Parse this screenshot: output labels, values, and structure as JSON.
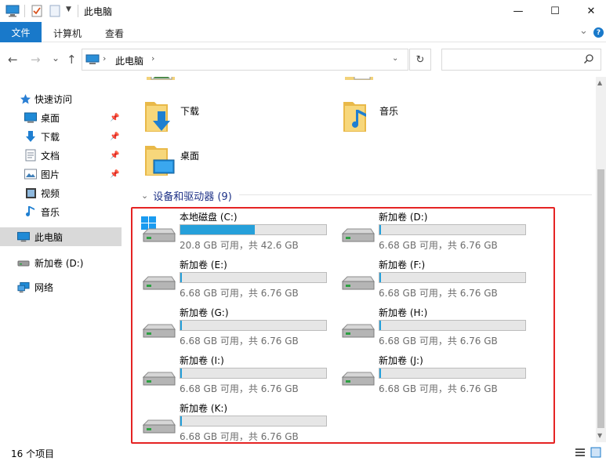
{
  "window": {
    "title": "此电脑",
    "minimize": "—",
    "maximize": "☐",
    "close": "✕"
  },
  "ribbon": {
    "tabs": [
      "文件",
      "计算机",
      "查看"
    ],
    "collapse": "⌄",
    "help": "?"
  },
  "nav": {
    "back": "←",
    "forward": "→",
    "recent": "⌄",
    "up": "↑",
    "address_root_chevron": "›",
    "address_location": "此电脑",
    "address_chevron": "›",
    "address_dropdown": "⌄",
    "refresh": "↻",
    "search_placeholder": ""
  },
  "sidebar": {
    "quick_access": "快速访问",
    "items": [
      {
        "label": "桌面",
        "icon": "desktop-icon",
        "pinned": true
      },
      {
        "label": "下载",
        "icon": "download-icon",
        "pinned": true
      },
      {
        "label": "文档",
        "icon": "document-icon",
        "pinned": true
      },
      {
        "label": "图片",
        "icon": "picture-icon",
        "pinned": true
      },
      {
        "label": "视频",
        "icon": "video-icon",
        "pinned": false
      },
      {
        "label": "音乐",
        "icon": "music-icon",
        "pinned": false
      }
    ],
    "this_pc": "此电脑",
    "drive": "新加卷 (D:)",
    "network": "网络"
  },
  "folders": {
    "downloads": "下载",
    "music": "音乐",
    "desktop": "桌面"
  },
  "devices": {
    "group_title": "设备和驱动器 (9)",
    "drives": [
      {
        "name": "本地磁盘 (C:)",
        "info": "20.8 GB 可用，共 42.6 GB",
        "used_fraction": 0.51,
        "type": "system"
      },
      {
        "name": "新加卷 (D:)",
        "info": "6.68 GB 可用，共 6.76 GB",
        "used_fraction": 0.012,
        "type": "disk"
      },
      {
        "name": "新加卷 (E:)",
        "info": "6.68 GB 可用，共 6.76 GB",
        "used_fraction": 0.012,
        "type": "disk"
      },
      {
        "name": "新加卷 (F:)",
        "info": "6.68 GB 可用，共 6.76 GB",
        "used_fraction": 0.012,
        "type": "disk"
      },
      {
        "name": "新加卷 (G:)",
        "info": "6.68 GB 可用，共 6.76 GB",
        "used_fraction": 0.012,
        "type": "disk"
      },
      {
        "name": "新加卷 (H:)",
        "info": "6.68 GB 可用，共 6.76 GB",
        "used_fraction": 0.012,
        "type": "disk"
      },
      {
        "name": "新加卷 (I:)",
        "info": "6.68 GB 可用，共 6.76 GB",
        "used_fraction": 0.012,
        "type": "disk"
      },
      {
        "name": "新加卷 (J:)",
        "info": "6.68 GB 可用，共 6.76 GB",
        "used_fraction": 0.012,
        "type": "disk"
      },
      {
        "name": "新加卷 (K:)",
        "info": "6.68 GB 可用，共 6.76 GB",
        "used_fraction": 0.012,
        "type": "disk"
      }
    ]
  },
  "status": {
    "item_count": "16 个项目"
  },
  "colors": {
    "accent": "#1979ca",
    "bar_fill": "#26a0da",
    "highlight_box": "#e52323",
    "group_title": "#1e3287"
  }
}
